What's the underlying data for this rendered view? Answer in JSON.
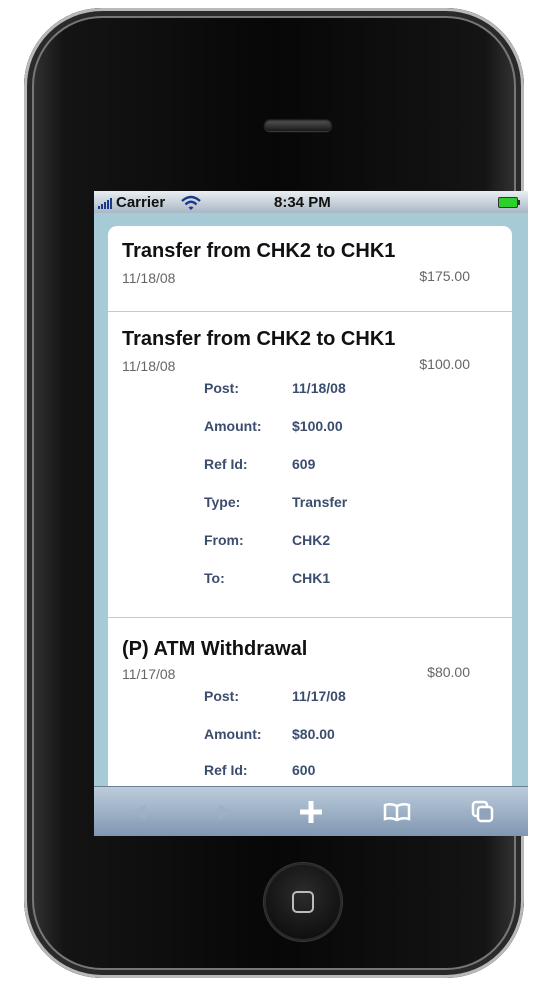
{
  "status": {
    "carrier": "Carrier",
    "time": "8:34 PM"
  },
  "transactions": [
    {
      "title": "Transfer from CHK2 to CHK1",
      "date": "11/18/08",
      "amount": "$175.00"
    },
    {
      "title": "Transfer from CHK2 to CHK1",
      "date": "11/18/08",
      "amount": "$100.00",
      "details": [
        {
          "label": "Post:",
          "value": "11/18/08"
        },
        {
          "label": "Amount:",
          "value": "$100.00"
        },
        {
          "label": "Ref Id:",
          "value": "609"
        },
        {
          "label": "Type:",
          "value": "Transfer"
        },
        {
          "label": "From:",
          "value": "CHK2"
        },
        {
          "label": "To:",
          "value": "CHK1"
        }
      ]
    },
    {
      "title": "(P) ATM Withdrawal",
      "date": "11/17/08",
      "amount": "$80.00",
      "details": [
        {
          "label": "Post:",
          "value": "11/17/08"
        },
        {
          "label": "Amount:",
          "value": "$80.00"
        },
        {
          "label": "Ref Id:",
          "value": "600"
        }
      ]
    }
  ],
  "toolbar": {
    "icons": [
      "back-icon",
      "forward-icon",
      "plus-icon",
      "bookmarks-icon",
      "pages-icon"
    ]
  }
}
